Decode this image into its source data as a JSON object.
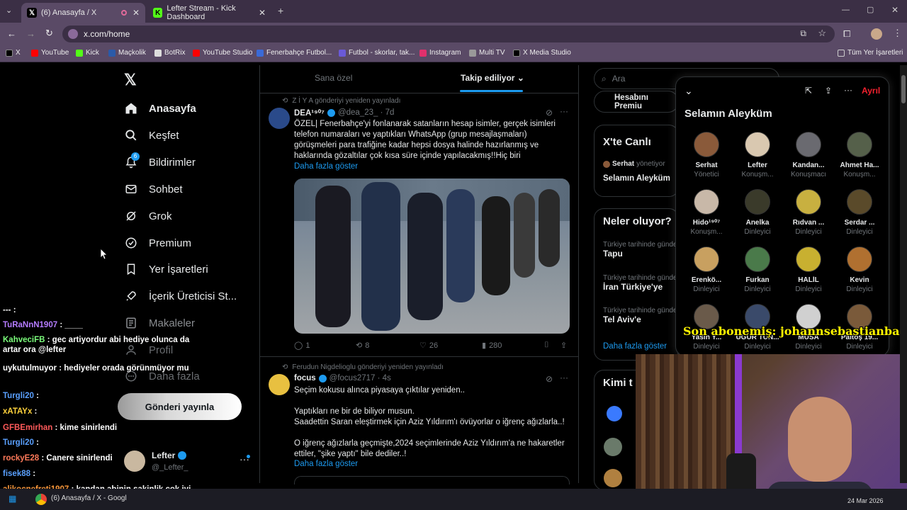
{
  "browser": {
    "tabs": [
      {
        "title": "(6) Anasayfa / X",
        "active": true
      },
      {
        "title": "Lefter Stream - Kick Dashboard",
        "active": false
      }
    ],
    "url": "x.com/home",
    "bookmarks": [
      "X",
      "YouTube",
      "Kick",
      "Maçkolik",
      "BotRix",
      "YouTube Studio",
      "Fenerbahçe Futbol...",
      "Futbol - skorlar, tak...",
      "Instagram",
      "Multi TV",
      "X Media Studio"
    ],
    "all_bookmarks": "Tüm Yer İşaretleri"
  },
  "nav": {
    "items": [
      {
        "label": "Anasayfa",
        "icon": "home-icon"
      },
      {
        "label": "Keşfet",
        "icon": "search-icon"
      },
      {
        "label": "Bildirimler",
        "icon": "bell-icon",
        "badge": "6"
      },
      {
        "label": "Sohbet",
        "icon": "mail-icon"
      },
      {
        "label": "Grok",
        "icon": "grok-icon"
      },
      {
        "label": "Premium",
        "icon": "verified-icon"
      },
      {
        "label": "Yer İşaretleri",
        "icon": "bookmark-icon"
      },
      {
        "label": "İçerik Üreticisi St...",
        "icon": "rocket-icon"
      },
      {
        "label": "Makaleler",
        "icon": "article-icon"
      },
      {
        "label": "Profil",
        "icon": "person-icon"
      },
      {
        "label": "Daha fazla",
        "icon": "more-icon"
      }
    ],
    "post_button": "Gönderi yayınla",
    "account": {
      "name": "Lefter",
      "handle": "@_Lefter_"
    }
  },
  "feed": {
    "tabs": [
      "Sana özel",
      "Takip ediliyor"
    ],
    "tweets": [
      {
        "repost_by": "Z İ Y A gönderiyi yeniden yayınladı",
        "name": "DEA¹⁹⁰⁷",
        "handle": "@dea_23_ · 7d",
        "text": "ÖZEL| Fenerbahçe'yi fonlanarak satanların hesap isimler, gerçek isimleri telefon numaraları ve yaptıkları WhatsApp (grup mesajlaşmaları) görüşmeleri para trafiğine kadar hepsi dosya halinde hazırlanmış ve haklarında gözaltılar çok kısa süre içinde yapılacakmış!!Hiç biri",
        "more": "Daha fazla göster",
        "stats": {
          "replies": "1",
          "reposts": "8",
          "likes": "26",
          "views": "280"
        }
      },
      {
        "repost_by": "Ferudun Nigdelioglu gönderiyi yeniden yayınladı",
        "name": "focus",
        "handle": "@focus2717 · 4s",
        "lines": [
          "Seçim kokusu alınca piyasaya çıktılar yeniden..",
          "",
          "Yaptıkları ne bir de biliyor musun.",
          "Saadettin Saran eleştirmek için Aziz Yıldırım'ı övüyorlar o iğrenç ağızlarla..!",
          "",
          "O iğrenç ağızlarla geçmişte,2024 seçimlerinde Aziz Yıldırım'a ne hakaretler ettiler, \"şike yaptı\" bile dediler..!"
        ],
        "more": "Daha fazla göster"
      }
    ]
  },
  "right": {
    "search_placeholder": "Ara",
    "premium_btn": "Hesabını Premiu",
    "live_title": "X'te Canlı",
    "live_host": "Serhat",
    "live_host_role": "yönetiyor",
    "live_space": "Selamın Aleyküm",
    "trends_title": "Neler oluyor?",
    "trends": [
      {
        "context": "Türkiye tarihinde günde",
        "name": "Tapu"
      },
      {
        "context": "Türkiye tarihinde günde",
        "name": "İran Türkiye'ye"
      },
      {
        "context": "Türkiye tarihinde günde",
        "name": "Tel Aviv'e"
      }
    ],
    "show_more": "Daha fazla göster",
    "who_to_follow": "Kimi t"
  },
  "space": {
    "title": "Selamın Aleyküm",
    "leave": "Ayrıl",
    "participants": [
      {
        "name": "Serhat",
        "role": "Yönetici",
        "color": "#8a5a3a"
      },
      {
        "name": "Lefter",
        "role": "Konuşm...",
        "color": "#d9c8b0"
      },
      {
        "name": "Kandan...",
        "role": "Konuşmacı",
        "color": "#6a6a70"
      },
      {
        "name": "Ahmet Ha...",
        "role": "Konuşm...",
        "color": "#55604a"
      },
      {
        "name": "Hido¹⁹⁰⁷",
        "role": "Konuşm...",
        "color": "#c8b8a8"
      },
      {
        "name": "Anelka",
        "role": "Dinleyici",
        "color": "#3a3a2a"
      },
      {
        "name": "Rıdvan ...",
        "role": "Dinleyici",
        "color": "#c8b040"
      },
      {
        "name": "Serdar ...",
        "role": "Dinleyici",
        "color": "#5a4a2a"
      },
      {
        "name": "Erenkö...",
        "role": "Dinleyici",
        "color": "#c8a060"
      },
      {
        "name": "Furkan",
        "role": "Dinleyici",
        "color": "#4a7a4a"
      },
      {
        "name": "HALİL",
        "role": "Dinleyici",
        "color": "#c8b030"
      },
      {
        "name": "Kevin",
        "role": "Dinleyici",
        "color": "#b07030"
      },
      {
        "name": "Yasin Y...",
        "role": "Dinleyici",
        "color": "#6a5a4a"
      },
      {
        "name": "UĞUR TUN...",
        "role": "Dinleyici",
        "color": "#3a4a6a"
      },
      {
        "name": "MUSA",
        "role": "Dinleyici",
        "color": "#d0d0d0"
      },
      {
        "name": "Paltoş 19...",
        "role": "Dinleyici",
        "color": "#7a5a3a"
      }
    ]
  },
  "overlay": {
    "subscriber": "Son abonemiş: johannsebastianbach"
  },
  "chat": [
    {
      "user": "---",
      "color": "#ffffff",
      "msg": ""
    },
    {
      "user": "TuRaNnN1907",
      "color": "#b57cff",
      "msg": "____"
    },
    {
      "user": "KahveciFB",
      "color": "#7cff7c",
      "msg": "gec artiyordur abi hediye olunca da artar ora @lefter"
    },
    {
      "user": "uykutulmuyor",
      "color": "#ffffff",
      "msg": "hediyeler orada görünmüyor mu"
    },
    {
      "user": "Turgli20",
      "color": "#5aa0ff",
      "msg": ""
    },
    {
      "user": "xATAYx",
      "color": "#ffd23c",
      "msg": ""
    },
    {
      "user": "GFBEmirhan",
      "color": "#ff5a5a",
      "msg": "kime sinirlendi"
    },
    {
      "user": "Turgli20",
      "color": "#5aa0ff",
      "msg": ""
    },
    {
      "user": "rockyE28",
      "color": "#ff7a5a",
      "msg": "Canere sinirlendi"
    },
    {
      "user": "fisek88",
      "color": "#5aa0ff",
      "msg": ""
    },
    {
      "user": "alikocnefreti1907",
      "color": "#ff9a3c",
      "msg": "kandan abinin sakinlik çok iyi ya"
    }
  ],
  "taskbar": {
    "app_label": "(6) Anasayfa / X - Googl",
    "date": "24 Mar 2026"
  }
}
